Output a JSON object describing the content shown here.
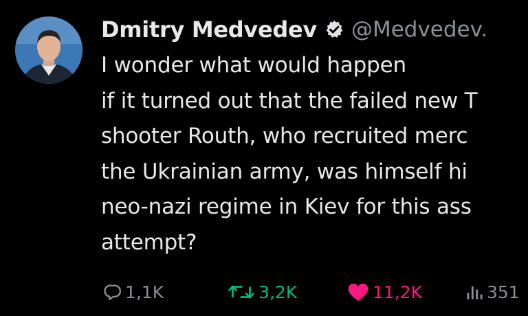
{
  "author": {
    "name": "Dmitry Medvedev",
    "handle": "@Medvedev.",
    "verified_icon": "verified-badge-icon",
    "avatar": "profile-photo"
  },
  "tweet": {
    "lines": [
      "I wonder what would happen",
      "if it turned out that the failed new T",
      "shooter Routh, who recruited merc",
      "the Ukrainian army, was himself hi",
      "neo-nazi regime in Kiev for this ass",
      "attempt?"
    ]
  },
  "actions": {
    "replies": {
      "icon": "reply-icon",
      "count": "1,1K"
    },
    "reposts": {
      "icon": "repost-icon",
      "count": "3,2K"
    },
    "likes": {
      "icon": "heart-icon",
      "count": "11,2K"
    },
    "views": {
      "icon": "views-icon",
      "count": "351"
    }
  },
  "colors": {
    "background": "#000000",
    "text": "#e7e9ea",
    "secondary": "#8b9096",
    "repost": "#00ba7c",
    "like": "#f91880"
  }
}
